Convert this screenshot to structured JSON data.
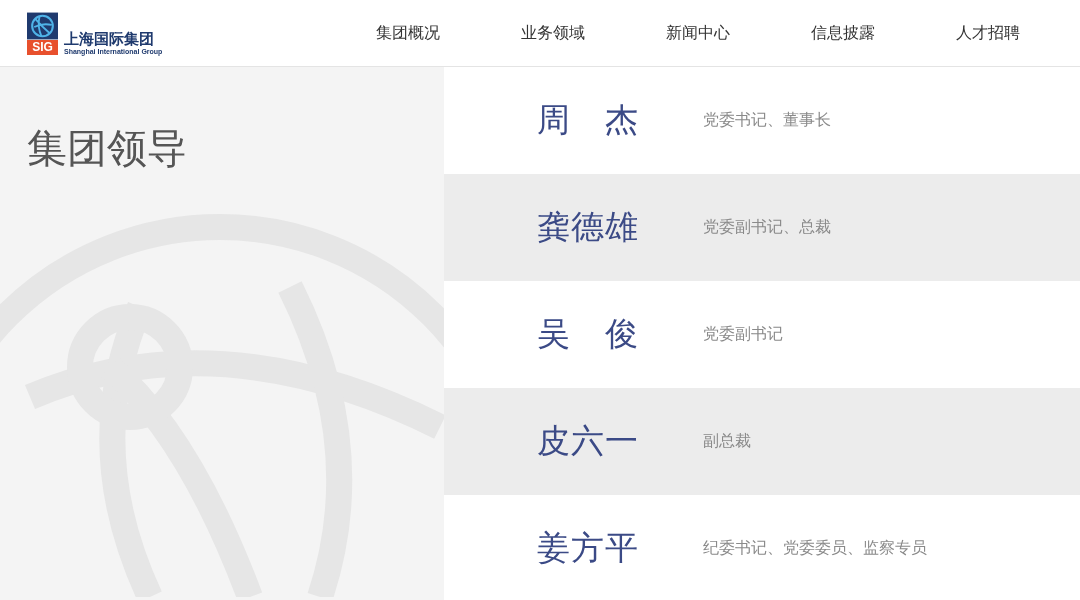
{
  "header": {
    "logo": {
      "badge": "SIG",
      "name": "上海国际集团",
      "subtitle": "Shanghai International Group"
    },
    "nav": [
      {
        "label": "集团概况"
      },
      {
        "label": "业务领域"
      },
      {
        "label": "新闻中心"
      },
      {
        "label": "信息披露"
      },
      {
        "label": "人才招聘"
      }
    ]
  },
  "section": {
    "title": "集团领导"
  },
  "leaders": [
    {
      "name": "周　杰",
      "position": "党委书记、董事长"
    },
    {
      "name": "龚德雄",
      "position": "党委副书记、总裁"
    },
    {
      "name": "吴　俊",
      "position": "党委副书记"
    },
    {
      "name": "皮六一",
      "position": "副总裁"
    },
    {
      "name": "姜方平",
      "position": "纪委书记、党委委员、监察专员"
    }
  ]
}
